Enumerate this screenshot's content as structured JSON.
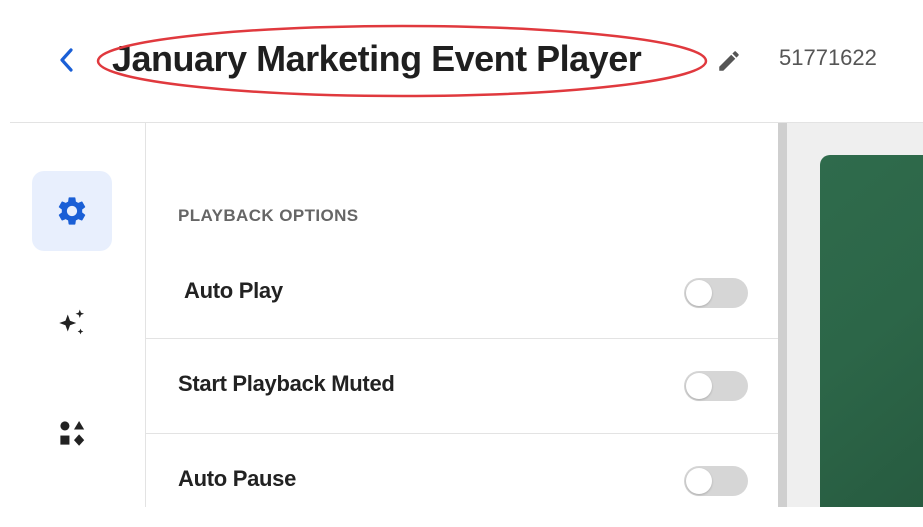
{
  "header": {
    "back_icon": "chevron-left-icon",
    "title": "January Marketing Event Player",
    "edit_icon": "pencil-icon",
    "player_id": "51771622",
    "annotation_color": "#e0393e"
  },
  "rail": {
    "items": [
      {
        "name": "settings",
        "icon": "gear-icon",
        "active": true
      },
      {
        "name": "ai-features",
        "icon": "sparkles-icon",
        "active": false
      },
      {
        "name": "plugins",
        "icon": "shapes-icon",
        "active": false
      }
    ]
  },
  "playback": {
    "section_title": "PLAYBACK OPTIONS",
    "options": [
      {
        "label": "Auto Play",
        "enabled": false
      },
      {
        "label": "Start Playback Muted",
        "enabled": false
      },
      {
        "label": "Auto Pause",
        "enabled": false
      }
    ]
  },
  "colors": {
    "accent": "#1a5fd6",
    "toggle_off": "#d6d6d6",
    "rail_active_bg": "#e8effd",
    "preview_green": "#2c6648"
  }
}
